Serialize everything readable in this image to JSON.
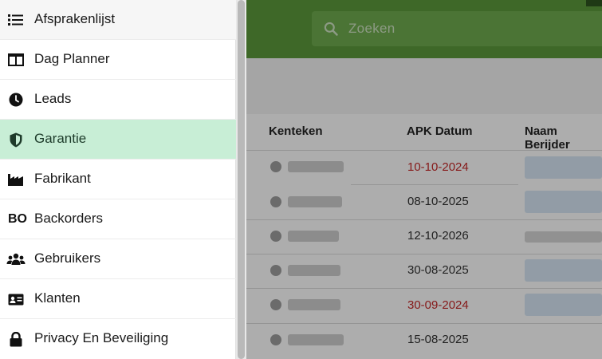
{
  "search": {
    "placeholder": "Zoeken"
  },
  "menu": {
    "items": [
      {
        "label": "Afsprakenlijst",
        "icon": "list-icon"
      },
      {
        "label": "Dag Planner",
        "icon": "columns-icon"
      },
      {
        "label": "Leads",
        "icon": "clock-icon"
      },
      {
        "label": "Garantie",
        "icon": "shield-icon"
      },
      {
        "label": "Fabrikant",
        "icon": "factory-icon"
      },
      {
        "label": "Backorders",
        "icon": "backorders-icon",
        "icon_text": "BO"
      },
      {
        "label": "Gebruikers",
        "icon": "users-icon"
      },
      {
        "label": "Klanten",
        "icon": "id-card-icon"
      },
      {
        "label": "Privacy En Beveiliging",
        "icon": "lock-icon"
      }
    ],
    "active_index": 3
  },
  "table": {
    "headers": [
      "Kenteken",
      "APK Datum",
      "Naam Berijder"
    ],
    "rows": [
      {
        "apk": "10-10-2024",
        "overdue": true
      },
      {
        "apk": "08-10-2025",
        "overdue": false
      },
      {
        "apk": "12-10-2026",
        "overdue": false
      },
      {
        "apk": "30-08-2025",
        "overdue": false
      },
      {
        "apk": "30-09-2024",
        "overdue": true
      },
      {
        "apk": "15-08-2025",
        "overdue": false
      }
    ]
  },
  "colors": {
    "topbar": "#5c9a3c",
    "active_item": "#c8eed6",
    "overdue_text": "#c62828"
  }
}
